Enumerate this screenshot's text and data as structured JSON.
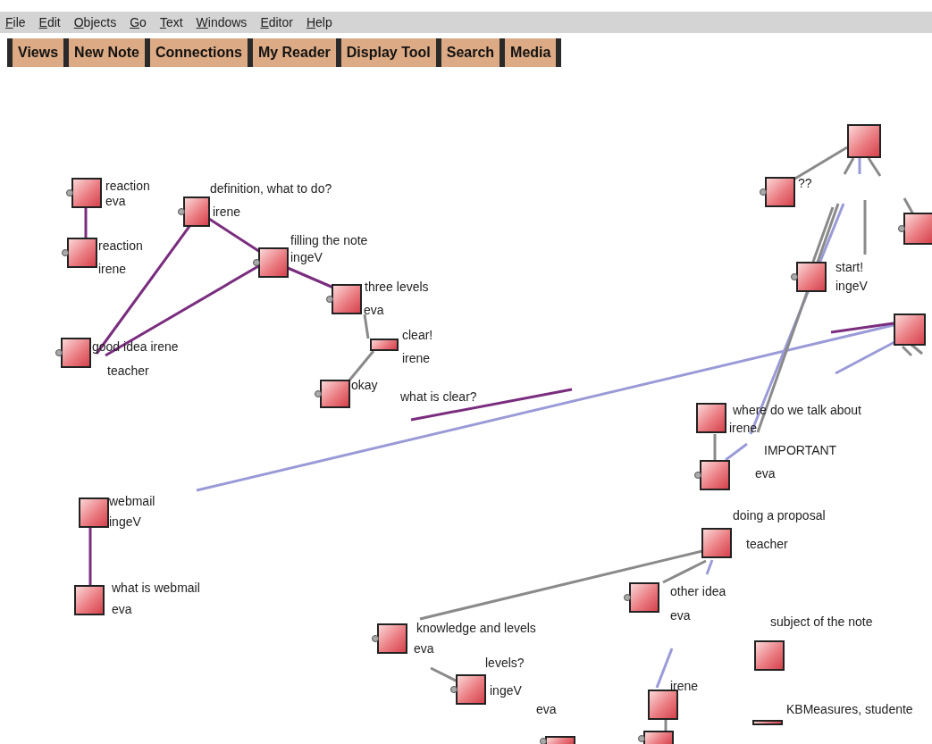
{
  "menu": [
    "File",
    "Edit",
    "Objects",
    "Go",
    "Text",
    "Windows",
    "Editor",
    "Help"
  ],
  "toolbar": [
    "Views",
    "New Note",
    "Connections",
    "My Reader",
    "Display Tool",
    "Search",
    "Media"
  ],
  "view": {
    "notes": [
      {
        "kind": "note",
        "title": "reaction",
        "author": "eva",
        "has_handle": true
      },
      {
        "kind": "note",
        "title": "reaction",
        "author": "irene",
        "has_handle": true
      },
      {
        "kind": "note",
        "title": "definition, what to do?",
        "author": "irene",
        "has_handle": true
      },
      {
        "kind": "note",
        "title": "filling the note",
        "author": "ingeV",
        "has_handle": true
      },
      {
        "kind": "note",
        "title": "three levels",
        "author": "eva",
        "has_handle": true
      },
      {
        "kind": "note",
        "title": "clear!",
        "author": "irene",
        "has_handle": false
      },
      {
        "kind": "note",
        "title": "good idea irene",
        "author": "teacher",
        "has_handle": true
      },
      {
        "kind": "note",
        "title": "okay",
        "has_handle": true
      },
      {
        "kind": "label",
        "title": "what is clear?"
      },
      {
        "kind": "note",
        "title": "??",
        "has_handle": true
      },
      {
        "kind": "note",
        "has_handle": false
      },
      {
        "kind": "note",
        "has_handle": true
      },
      {
        "kind": "note",
        "title": "start!",
        "author": "ingeV",
        "has_handle": true
      },
      {
        "kind": "note",
        "has_handle": false
      },
      {
        "kind": "note",
        "title": "where do we talk about",
        "author": "irene",
        "has_handle": false
      },
      {
        "kind": "note",
        "title": "IMPORTANT",
        "author": "eva",
        "has_handle": true
      },
      {
        "kind": "note",
        "title": "webmail",
        "author": "ingeV",
        "has_handle": false
      },
      {
        "kind": "note",
        "title": "what is webmail",
        "author": "eva",
        "has_handle": false
      },
      {
        "kind": "note",
        "title": "doing a proposal",
        "author": "teacher",
        "has_handle": false
      },
      {
        "kind": "note",
        "title": "other idea",
        "author": "eva",
        "has_handle": true
      },
      {
        "kind": "note",
        "title": "knowledge and levels",
        "author": "eva",
        "has_handle": true
      },
      {
        "kind": "note",
        "title": "levels?",
        "author": "ingeV",
        "has_handle": true
      },
      {
        "kind": "note",
        "title": "subject of the note",
        "has_handle": false
      },
      {
        "kind": "note",
        "title": "irene",
        "has_handle": false
      },
      {
        "kind": "label",
        "title": "eva"
      },
      {
        "kind": "note",
        "title": "KBMeasures, studente",
        "has_handle": false
      },
      {
        "kind": "note",
        "has_handle": true
      },
      {
        "kind": "note",
        "has_handle": true
      }
    ]
  }
}
